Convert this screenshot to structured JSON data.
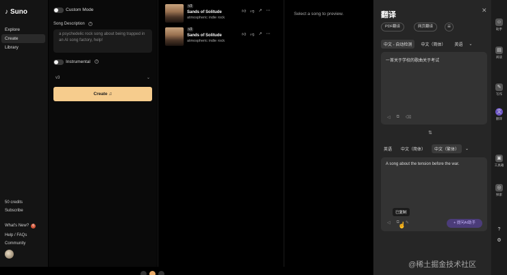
{
  "app": {
    "name": "Suno"
  },
  "nav": {
    "items": [
      "Explore",
      "Create",
      "Library"
    ],
    "credits": "50 credits",
    "subscribe": "Subscribe",
    "whats_new": "What's New?",
    "whats_new_count": "6",
    "help": "Help / FAQs",
    "community": "Community"
  },
  "create": {
    "custom_mode": "Custom Mode",
    "song_description_label": "Song Description",
    "song_description_value": "a psychedelic rock song about being trapped in an AI song factory, help!",
    "instrumental": "Instrumental",
    "version": "v3",
    "create_button": "Create"
  },
  "songs": [
    {
      "version": "v3",
      "title": "Sands of Solitude",
      "style": "atmospheric indie rock"
    },
    {
      "version": "v3",
      "title": "Sands of Solitude",
      "style": "atmospheric indie rock"
    }
  ],
  "preview": {
    "empty_text": "Select a song to preview."
  },
  "translate": {
    "title": "翻译",
    "pills": [
      "PDF翻译",
      "网页翻译"
    ],
    "source_langs": [
      "中文 - 自动检测",
      "中文（简体）",
      "英语"
    ],
    "source_text": "一首关于学校的歌曲关于考试",
    "target_langs": [
      "英语",
      "中文（简体）",
      "中文（繁体）"
    ],
    "target_text": "A song about the tension before the war.",
    "tooltip": "已复制",
    "prompt_button": "+ 提问AI助手"
  },
  "rail": {
    "labels": [
      "助手",
      "阅读",
      "写作",
      "翻译",
      "工具箱",
      "探索"
    ]
  },
  "watermark": "@稀土掘金技术社区"
}
